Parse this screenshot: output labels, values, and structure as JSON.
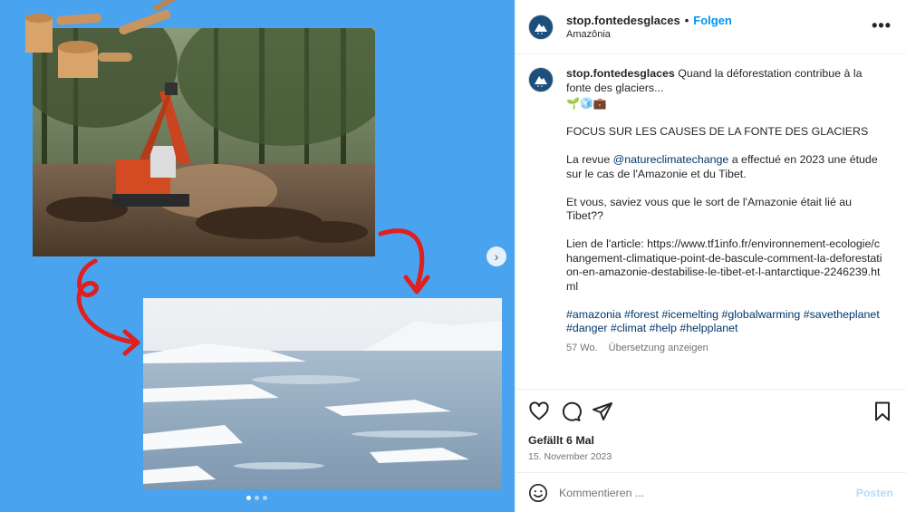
{
  "colors": {
    "accent": "#0095f6",
    "link": "#00376b",
    "media_bg": "#4aa3ef",
    "arrow": "#e01f1f"
  },
  "header": {
    "username": "stop.fontedesglaces",
    "separator": "•",
    "follow_label": "Folgen",
    "location": "Amazônia",
    "more_icon": "more-horizontal-icon"
  },
  "caption": {
    "username": "stop.fontedesglaces",
    "text": "Quand la déforestation contribue à la fonte des glaciers...",
    "emoji": "🌱🧊💼",
    "headline": "FOCUS SUR LES CAUSES DE LA FONTE DES GLACIERS",
    "para1_before": "La revue ",
    "para1_mention": "@natureclimatechange",
    "para1_after": " a effectué en 2023 une étude sur le cas de l'Amazonie et du Tibet.",
    "question": "Et vous, saviez vous que le sort de l'Amazonie était lié au Tibet??",
    "link_text": "Lien de l'article: https://www.tf1info.fr/environnement-ecologie/changement-climatique-point-de-bascule-comment-la-deforestation-en-amazonie-destabilise-le-tibet-et-l-antarctique-2246239.html",
    "hashtags_line1": "#amazonia #forest #icemelting #globalwarming #savetheplanet",
    "hashtags_line2": "#danger #climat #help #helpplanet",
    "age": "57 Wo.",
    "translate_label": "Übersetzung anzeigen"
  },
  "actions": {
    "likes": "Gefällt 6 Mal",
    "date": "15. November 2023"
  },
  "comment": {
    "placeholder": "Kommentieren ...",
    "post_label": "Posten"
  },
  "carousel": {
    "slide_count": 3,
    "active_index": 0,
    "next_icon": "chevron-right-icon"
  }
}
